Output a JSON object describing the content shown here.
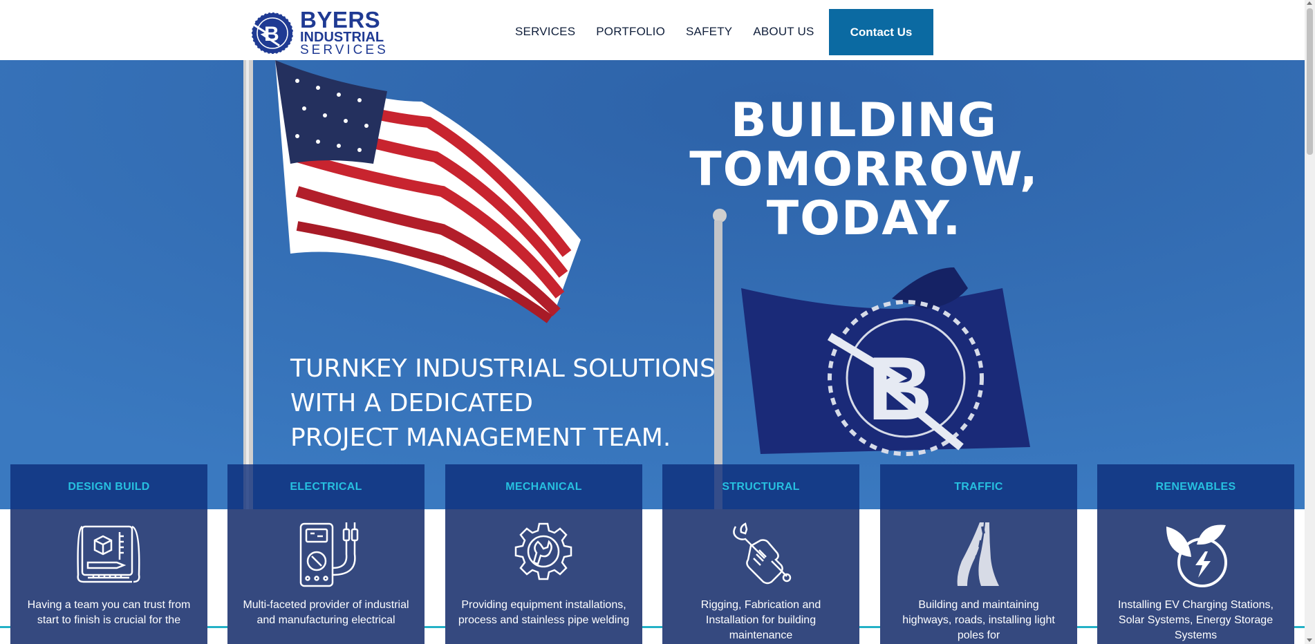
{
  "brand": {
    "name_line1": "BYERS",
    "name_line2": "INDUSTRIAL",
    "name_line3": "SERVICES",
    "logo_icon": "byers-b-gear-logo",
    "color": "#1f3a93"
  },
  "nav": {
    "items": [
      {
        "label": "SERVICES"
      },
      {
        "label": "PORTFOLIO"
      },
      {
        "label": "SAFETY"
      },
      {
        "label": "ABOUT US"
      }
    ],
    "contact_label": "Contact Us",
    "contact_color": "#0b6aa2"
  },
  "hero": {
    "title_lines": [
      "BUILDING",
      "TOMORROW,",
      "TODAY."
    ],
    "subtitle_lines": [
      "TURNKEY INDUSTRIAL SOLUTIONS",
      "WITH A DEDICATED",
      "PROJECT MANAGEMENT TEAM."
    ],
    "background": "flags-american-and-byers-on-blue-sky"
  },
  "services": [
    {
      "title": "DESIGN BUILD",
      "icon": "blueprint-icon",
      "desc": "Having a team you can trust from start to finish is crucial for the"
    },
    {
      "title": "ELECTRICAL",
      "icon": "multimeter-icon",
      "desc": "Multi-faceted provider of industrial and manufacturing electrical"
    },
    {
      "title": "MECHANICAL",
      "icon": "gear-wrench-icon",
      "desc": "Providing equipment installations, process and stainless pipe welding"
    },
    {
      "title": "STRUCTURAL",
      "icon": "hand-wrench-icon",
      "desc": "Rigging, Fabrication and Installation for building maintenance"
    },
    {
      "title": "TRAFFIC",
      "icon": "road-icon",
      "desc": "Building and maintaining highways, roads, installing light poles for"
    },
    {
      "title": "RENEWABLES",
      "icon": "leaf-bolt-icon",
      "desc": "Installing EV Charging Stations, Solar Systems, Energy Storage Systems"
    }
  ],
  "colors": {
    "accent_line": "#23b1c6",
    "card_title": "#27c0e0",
    "card_body": "#35497f"
  }
}
